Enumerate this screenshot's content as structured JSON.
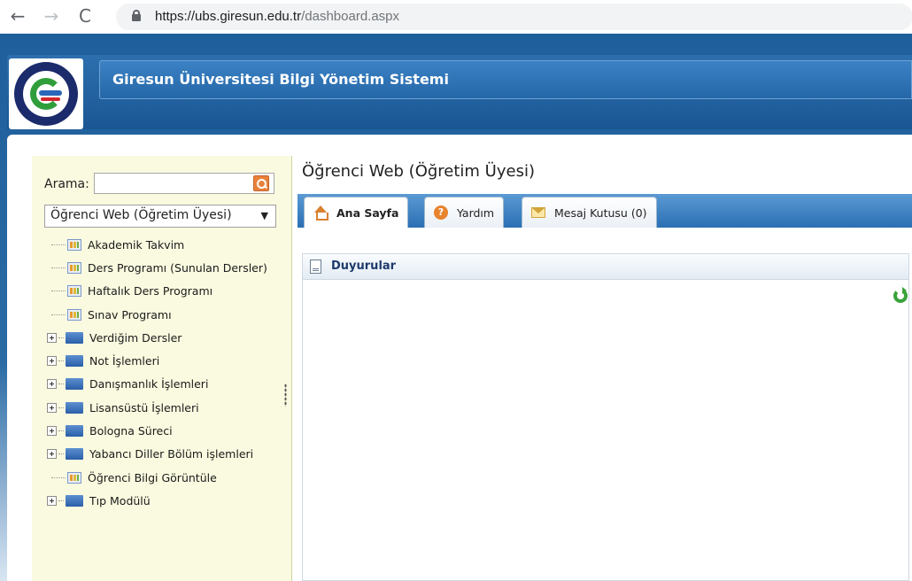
{
  "browser": {
    "back_icon": "arrow-left-icon",
    "forward_icon": "arrow-right-icon",
    "reload_icon": "reload-icon",
    "url_host": "https://ubs.giresun.edu.tr",
    "url_path": "/dashboard.aspx"
  },
  "header": {
    "app_title": "Giresun Üniversitesi Bilgi Yönetim Sistemi",
    "logo": "giresun-university-seal"
  },
  "sidebar": {
    "search_label": "Arama:",
    "search_value": "",
    "selected_module": "Öğrenci Web (Öğretim Üyesi)",
    "items": [
      {
        "label": "Akademik Takvim",
        "type": "page"
      },
      {
        "label": "Ders Programı (Sunulan Dersler)",
        "type": "page"
      },
      {
        "label": "Haftalık Ders Programı",
        "type": "page"
      },
      {
        "label": "Sınav Programı",
        "type": "page"
      },
      {
        "label": "Verdiğim Dersler",
        "type": "folder"
      },
      {
        "label": "Not İşlemleri",
        "type": "folder"
      },
      {
        "label": "Danışmanlık İşlemleri",
        "type": "folder"
      },
      {
        "label": "Lisansüstü İşlemleri",
        "type": "folder"
      },
      {
        "label": "Bologna Süreci",
        "type": "folder"
      },
      {
        "label": "Yabancı Diller Bölüm işlemleri",
        "type": "folder"
      },
      {
        "label": "Öğrenci Bilgi Görüntüle",
        "type": "page"
      },
      {
        "label": "Tıp Modülü",
        "type": "folder"
      }
    ]
  },
  "main": {
    "heading": "Öğrenci Web (Öğretim Üyesi)",
    "tabs": [
      {
        "label": "Ana Sayfa",
        "icon": "home-icon",
        "active": true
      },
      {
        "label": "Yardım",
        "icon": "help-icon",
        "active": false
      },
      {
        "label": "Mesaj Kutusu (0)",
        "icon": "mail-icon",
        "active": false
      }
    ],
    "panel_title": "Duyurular"
  },
  "colors": {
    "header_blue": "#2567a8",
    "sidebar_bg": "#fafae0",
    "tab_strip": "#2b6fb3",
    "accent_orange": "#e8832e"
  }
}
